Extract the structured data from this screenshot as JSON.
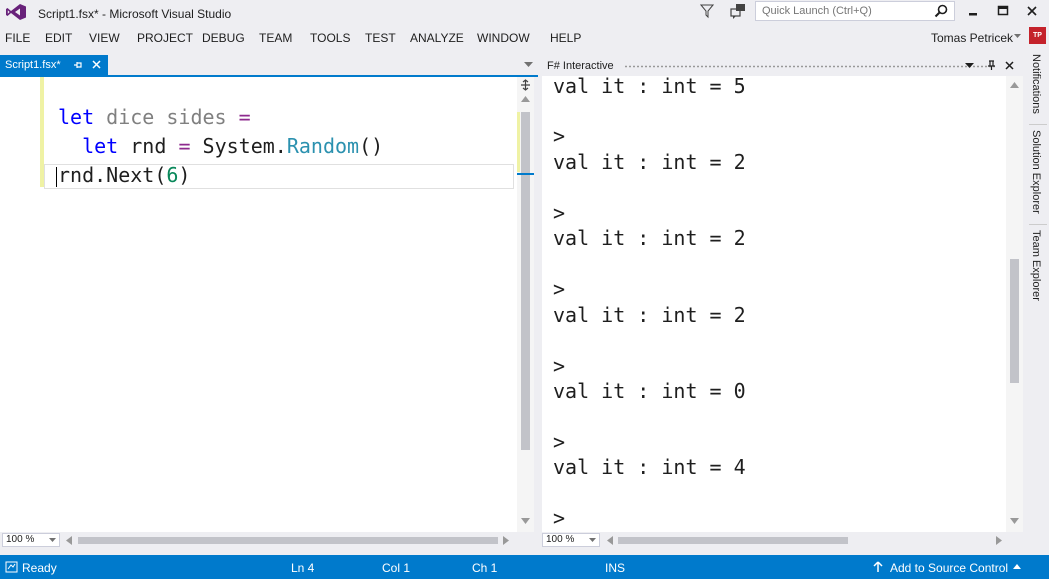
{
  "window": {
    "title": "Script1.fsx* - Microsoft Visual Studio",
    "quick_launch_placeholder": "Quick Launch (Ctrl+Q)",
    "icons": [
      "vs-logo-icon",
      "filter-icon",
      "feedback-icon",
      "search-icon",
      "minimize-icon",
      "maximize-icon",
      "close-icon"
    ]
  },
  "menu": {
    "items": [
      "FILE",
      "EDIT",
      "VIEW",
      "PROJECT",
      "DEBUG",
      "TEAM",
      "TOOLS",
      "TEST",
      "ANALYZE",
      "WINDOW",
      "HELP"
    ],
    "user_name": "Tomas Petricek",
    "avatar_initials": "TP"
  },
  "editor": {
    "tab_label": "Script1.fsx*",
    "zoom": "100 %",
    "code": {
      "line1": {
        "kw": "let",
        "name": "dice sides",
        "op": "="
      },
      "line2": {
        "kw": "let",
        "name": "rnd",
        "op": "=",
        "type_prefix": "System.",
        "type": "Random",
        "suffix": "()"
      },
      "line3": {
        "prefix": "rnd.Next(",
        "num": "6",
        "suffix": ")"
      }
    }
  },
  "fsi": {
    "title": "F# Interactive",
    "zoom": "100 %",
    "lines": [
      "val it : int = 5",
      ">",
      "val it : int = 2",
      ">",
      "val it : int = 2",
      ">",
      "val it : int = 2",
      ">",
      "val it : int = 0",
      ">",
      "val it : int = 4",
      ">"
    ]
  },
  "side_dock": [
    "Notifications",
    "Solution Explorer",
    "Team Explorer"
  ],
  "status": {
    "ready": "Ready",
    "ln": "Ln 4",
    "col": "Col 1",
    "ch": "Ch 1",
    "mode": "INS",
    "source_control": "Add to Source Control"
  },
  "colors": {
    "accent": "#007acc",
    "keyword": "#0000ff",
    "type": "#2b91af",
    "number": "#09885a",
    "avatar": "#c4222b"
  }
}
